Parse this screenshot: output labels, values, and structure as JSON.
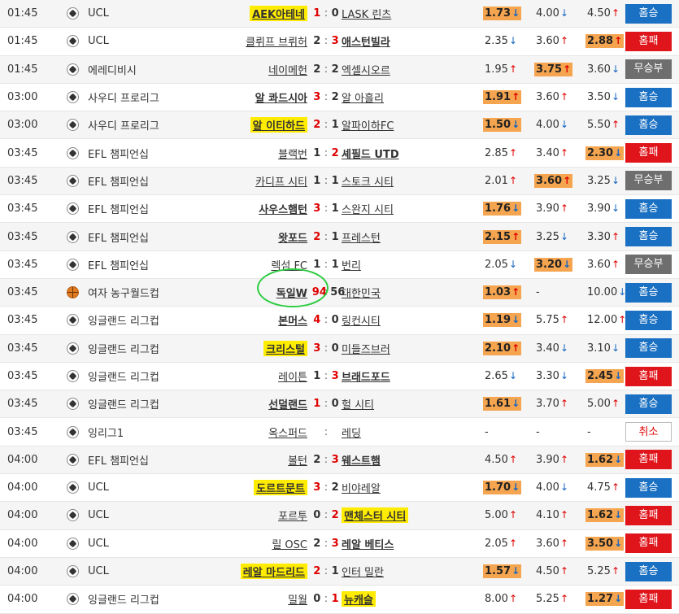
{
  "colors": {
    "home_badge": "#1a70c2",
    "away_badge": "#e0151b",
    "draw_badge": "#6e6e6e",
    "best_odd": "#f5a54f",
    "highlight": "#ffec00",
    "annotation_circle": "#2ecc40"
  },
  "matches": [
    {
      "time": "01:45",
      "sport": "soccer-ball-icon",
      "league": "UCL",
      "home": "AEK아테네",
      "hs": "1",
      "as": "0",
      "away": "LASK 린츠",
      "o1": "1.73",
      "o1d": "↓",
      "o2": "4.00",
      "o2d": "↓",
      "o3": "4.50",
      "o3d": "↑",
      "result": "홈승"
    },
    {
      "time": "01:45",
      "sport": "soccer-ball-icon",
      "league": "UCL",
      "home": "클뤼프 브뤼허",
      "hs": "2",
      "as": "3",
      "away": "애스턴빌라",
      "o1": "2.35",
      "o1d": "↓",
      "o2": "3.60",
      "o2d": "↑",
      "o3": "2.88",
      "o3d": "↑",
      "result": "홈패"
    },
    {
      "time": "01:45",
      "sport": "soccer-ball-icon",
      "league": "에레디비시",
      "home": "네이메헌",
      "hs": "2",
      "as": "2",
      "away": "엑셀시오르",
      "o1": "1.95",
      "o1d": "↑",
      "o2": "3.75",
      "o2d": "↑",
      "o3": "3.60",
      "o3d": "↓",
      "result": "무승부"
    },
    {
      "time": "03:00",
      "sport": "soccer-ball-icon",
      "league": "사우디 프로리그",
      "home": "알 콰드시아",
      "hs": "3",
      "as": "2",
      "away": "알 아흘리",
      "o1": "1.91",
      "o1d": "↑",
      "o2": "3.60",
      "o2d": "↑",
      "o3": "3.50",
      "o3d": "↓",
      "result": "홈승"
    },
    {
      "time": "03:00",
      "sport": "soccer-ball-icon",
      "league": "사우디 프로리그",
      "home": "알 이티하드",
      "hs": "2",
      "as": "1",
      "away": "알파이하FC",
      "o1": "1.50",
      "o1d": "↓",
      "o2": "4.00",
      "o2d": "↓",
      "o3": "5.50",
      "o3d": "↑",
      "result": "홈승"
    },
    {
      "time": "03:45",
      "sport": "soccer-ball-icon",
      "league": "EFL 챔피언십",
      "home": "블랙번",
      "hs": "1",
      "as": "2",
      "away": "셰필드 UTD",
      "o1": "2.85",
      "o1d": "↑",
      "o2": "3.40",
      "o2d": "↑",
      "o3": "2.30",
      "o3d": "↓",
      "result": "홈패"
    },
    {
      "time": "03:45",
      "sport": "soccer-ball-icon",
      "league": "EFL 챔피언십",
      "home": "카디프 시티",
      "hs": "1",
      "as": "1",
      "away": "스토크 시티",
      "o1": "2.01",
      "o1d": "↑",
      "o2": "3.60",
      "o2d": "↑",
      "o3": "3.25",
      "o3d": "↓",
      "result": "무승부"
    },
    {
      "time": "03:45",
      "sport": "soccer-ball-icon",
      "league": "EFL 챔피언십",
      "home": "사우스햄턴",
      "hs": "3",
      "as": "1",
      "away": "스완지 시티",
      "o1": "1.76",
      "o1d": "↓",
      "o2": "3.90",
      "o2d": "↑",
      "o3": "3.90",
      "o3d": "↓",
      "result": "홈승"
    },
    {
      "time": "03:45",
      "sport": "soccer-ball-icon",
      "league": "EFL 챔피언십",
      "home": "왓포드",
      "hs": "2",
      "as": "1",
      "away": "프레스턴",
      "o1": "2.15",
      "o1d": "↑",
      "o2": "3.25",
      "o2d": "↓",
      "o3": "3.30",
      "o3d": "↑",
      "result": "홈승"
    },
    {
      "time": "03:45",
      "sport": "soccer-ball-icon",
      "league": "EFL 챔피언십",
      "home": "렉섬 FC",
      "hs": "1",
      "as": "1",
      "away": "번리",
      "o1": "2.05",
      "o1d": "↓",
      "o2": "3.20",
      "o2d": "↓",
      "o3": "3.60",
      "o3d": "↑",
      "result": "무승부"
    },
    {
      "time": "03:45",
      "sport": "basketball-icon",
      "league": "여자 농구월드컵",
      "home": "독일W",
      "hs": "94",
      "as": "56",
      "away": "대한민국",
      "o1": "1.03",
      "o1d": "↑",
      "o2": "-",
      "o2d": "",
      "o3": "10.00",
      "o3d": "↓",
      "result": "홈승"
    },
    {
      "time": "03:45",
      "sport": "soccer-ball-icon",
      "league": "잉글랜드 리그컵",
      "home": "본머스",
      "hs": "4",
      "as": "0",
      "away": "링컨시티",
      "o1": "1.19",
      "o1d": "↓",
      "o2": "5.75",
      "o2d": "↑",
      "o3": "12.00",
      "o3d": "↑",
      "result": "홈승"
    },
    {
      "time": "03:45",
      "sport": "soccer-ball-icon",
      "league": "잉글랜드 리그컵",
      "home": "크리스털",
      "hs": "3",
      "as": "0",
      "away": "미들즈브러",
      "o1": "2.10",
      "o1d": "↑",
      "o2": "3.40",
      "o2d": "↓",
      "o3": "3.10",
      "o3d": "↓",
      "result": "홈승"
    },
    {
      "time": "03:45",
      "sport": "soccer-ball-icon",
      "league": "잉글랜드 리그컵",
      "home": "레이튼",
      "hs": "1",
      "as": "3",
      "away": "브래드포드",
      "o1": "2.65",
      "o1d": "↓",
      "o2": "3.30",
      "o2d": "↓",
      "o3": "2.45",
      "o3d": "↓",
      "result": "홈패"
    },
    {
      "time": "03:45",
      "sport": "soccer-ball-icon",
      "league": "잉글랜드 리그컵",
      "home": "선덜랜드",
      "hs": "1",
      "as": "0",
      "away": "헐 시티",
      "o1": "1.61",
      "o1d": "↓",
      "o2": "3.70",
      "o2d": "↑",
      "o3": "5.00",
      "o3d": "↑",
      "result": "홈승"
    },
    {
      "time": "03:45",
      "sport": "soccer-ball-icon",
      "league": "잉리그1",
      "home": "옥스퍼드",
      "hs": "",
      "as": "",
      "away": "레딩",
      "o1": "-",
      "o1d": "",
      "o2": "-",
      "o2d": "",
      "o3": "-",
      "o3d": "",
      "result": "취소"
    },
    {
      "time": "04:00",
      "sport": "soccer-ball-icon",
      "league": "EFL 챔피언십",
      "home": "볼턴",
      "hs": "2",
      "as": "3",
      "away": "웨스트햄",
      "o1": "4.50",
      "o1d": "↑",
      "o2": "3.90",
      "o2d": "↑",
      "o3": "1.62",
      "o3d": "↓",
      "result": "홈패"
    },
    {
      "time": "04:00",
      "sport": "soccer-ball-icon",
      "league": "UCL",
      "home": "도르트문트",
      "hs": "3",
      "as": "2",
      "away": "비야레알",
      "o1": "1.70",
      "o1d": "↓",
      "o2": "4.00",
      "o2d": "↓",
      "o3": "4.75",
      "o3d": "↑",
      "result": "홈승"
    },
    {
      "time": "04:00",
      "sport": "soccer-ball-icon",
      "league": "UCL",
      "home": "포르투",
      "hs": "0",
      "as": "2",
      "away": "맨체스터 시티",
      "o1": "5.00",
      "o1d": "↑",
      "o2": "4.10",
      "o2d": "↑",
      "o3": "1.62",
      "o3d": "↓",
      "result": "홈패"
    },
    {
      "time": "04:00",
      "sport": "soccer-ball-icon",
      "league": "UCL",
      "home": "릴 OSC",
      "hs": "2",
      "as": "3",
      "away": "레알 베티스",
      "o1": "2.05",
      "o1d": "↑",
      "o2": "3.60",
      "o2d": "↑",
      "o3": "3.50",
      "o3d": "↓",
      "result": "홈패"
    },
    {
      "time": "04:00",
      "sport": "soccer-ball-icon",
      "league": "UCL",
      "home": "레알 마드리드",
      "hs": "2",
      "as": "1",
      "away": "인터 밀란",
      "o1": "1.57",
      "o1d": "↓",
      "o2": "4.50",
      "o2d": "↑",
      "o3": "5.25",
      "o3d": "↑",
      "result": "홈승"
    },
    {
      "time": "04:00",
      "sport": "soccer-ball-icon",
      "league": "잉글랜드 리그컵",
      "home": "밀월",
      "hs": "0",
      "as": "1",
      "away": "뉴캐슬",
      "o1": "8.00",
      "o1d": "↑",
      "o2": "5.25",
      "o2d": "↑",
      "o3": "1.27",
      "o3d": "↓",
      "result": "홈패"
    }
  ]
}
